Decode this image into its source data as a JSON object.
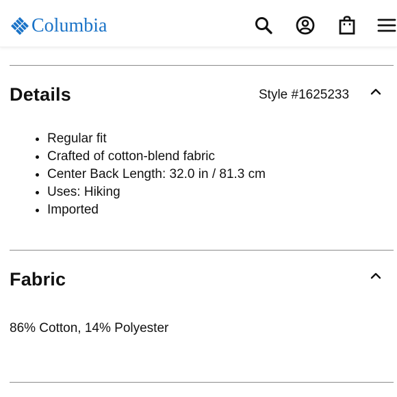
{
  "header": {
    "brand": "Columbia",
    "brand_color": "#1a73c7",
    "icons": [
      "search-icon",
      "account-icon",
      "shopping-bag-icon",
      "menu-icon"
    ]
  },
  "details": {
    "title": "Details",
    "style_number": "Style #1625233",
    "toggle_icon": "chevron-up-icon",
    "bullets": [
      "Regular fit",
      "Crafted of cotton-blend fabric",
      "Center Back Length: 32.0 in / 81.3 cm",
      "Uses: Hiking",
      "Imported"
    ]
  },
  "fabric": {
    "title": "Fabric",
    "toggle_icon": "chevron-up-icon",
    "content": "86% Cotton, 14% Polyester"
  }
}
